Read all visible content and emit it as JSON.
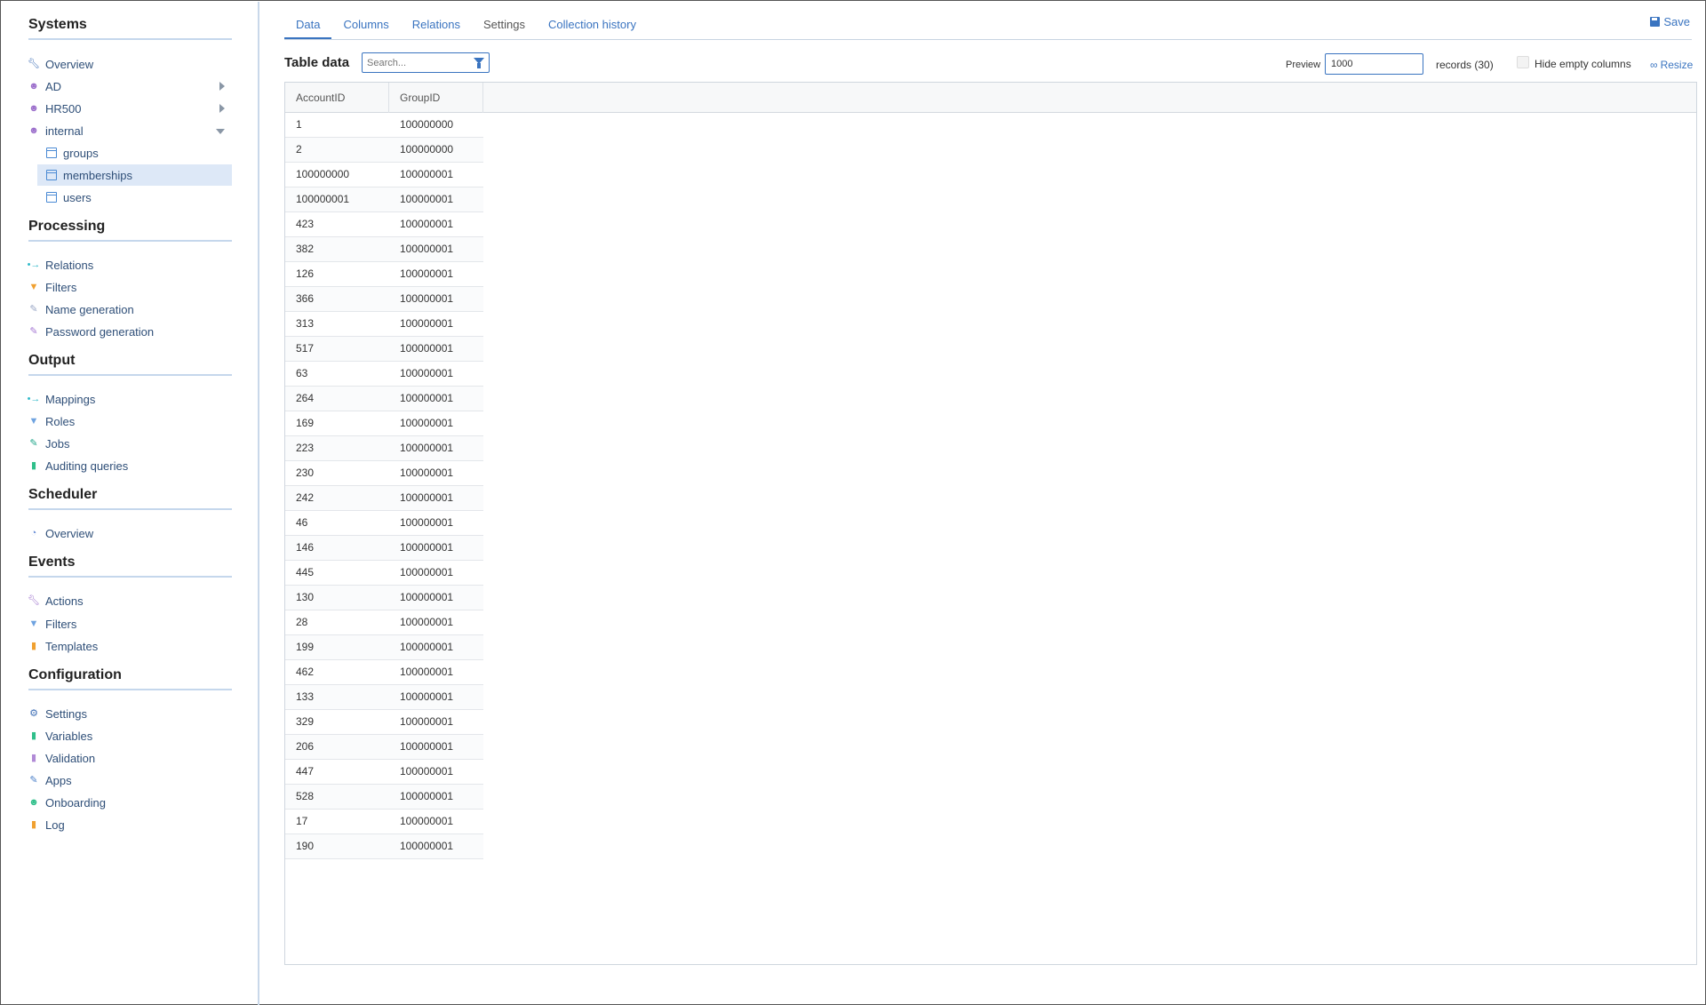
{
  "sidebar": {
    "systems": {
      "title": "Systems",
      "items": [
        {
          "label": "Overview",
          "icon": "wrench-icon"
        },
        {
          "label": "AD",
          "icon": "users-icon"
        },
        {
          "label": "HR500",
          "icon": "users-icon"
        },
        {
          "label": "internal",
          "icon": "users-icon"
        }
      ],
      "sub_items": [
        {
          "label": "groups",
          "icon": "table-icon"
        },
        {
          "label": "memberships",
          "icon": "table-icon"
        },
        {
          "label": "users",
          "icon": "table-icon"
        }
      ]
    },
    "processing": {
      "title": "Processing",
      "items": [
        {
          "label": "Relations",
          "icon": "relations-icon"
        },
        {
          "label": "Filters",
          "icon": "filter-icon"
        },
        {
          "label": "Name generation",
          "icon": "name-generation-icon"
        },
        {
          "label": "Password generation",
          "icon": "password-generation-icon"
        }
      ]
    },
    "output": {
      "title": "Output",
      "items": [
        {
          "label": "Mappings",
          "icon": "mappings-icon"
        },
        {
          "label": "Roles",
          "icon": "filter-icon"
        },
        {
          "label": "Jobs",
          "icon": "jobs-icon"
        },
        {
          "label": "Auditing queries",
          "icon": "document-icon"
        }
      ]
    },
    "scheduler": {
      "title": "Scheduler",
      "items": [
        {
          "label": "Overview",
          "icon": "clock-icon"
        }
      ]
    },
    "events": {
      "title": "Events",
      "items": [
        {
          "label": "Actions",
          "icon": "wrench-icon"
        },
        {
          "label": "Filters",
          "icon": "filter-icon"
        },
        {
          "label": "Templates",
          "icon": "document-icon"
        }
      ]
    },
    "configuration": {
      "title": "Configuration",
      "items": [
        {
          "label": "Settings",
          "icon": "gear-icon"
        },
        {
          "label": "Variables",
          "icon": "document-icon"
        },
        {
          "label": "Validation",
          "icon": "document-icon"
        },
        {
          "label": "Apps",
          "icon": "apps-icon"
        },
        {
          "label": "Onboarding",
          "icon": "users-icon"
        },
        {
          "label": "Log",
          "icon": "document-icon"
        }
      ]
    }
  },
  "tabs": [
    {
      "label": "Data"
    },
    {
      "label": "Columns"
    },
    {
      "label": "Relations"
    },
    {
      "label": "Settings"
    },
    {
      "label": "Collection history"
    }
  ],
  "toolbar": {
    "save_label": "Save",
    "table_title": "Table data",
    "search_placeholder": "Search...",
    "preview_label": "Preview",
    "preview_value": "1000",
    "records_label": "records (30)",
    "hide_empty_label": "Hide empty columns",
    "resize_label": "Resize"
  },
  "table": {
    "columns": [
      "AccountID",
      "GroupID"
    ],
    "rows": [
      [
        "1",
        "100000000"
      ],
      [
        "2",
        "100000000"
      ],
      [
        "100000000",
        "100000001"
      ],
      [
        "100000001",
        "100000001"
      ],
      [
        "423",
        "100000001"
      ],
      [
        "382",
        "100000001"
      ],
      [
        "126",
        "100000001"
      ],
      [
        "366",
        "100000001"
      ],
      [
        "313",
        "100000001"
      ],
      [
        "517",
        "100000001"
      ],
      [
        "63",
        "100000001"
      ],
      [
        "264",
        "100000001"
      ],
      [
        "169",
        "100000001"
      ],
      [
        "223",
        "100000001"
      ],
      [
        "230",
        "100000001"
      ],
      [
        "242",
        "100000001"
      ],
      [
        "46",
        "100000001"
      ],
      [
        "146",
        "100000001"
      ],
      [
        "445",
        "100000001"
      ],
      [
        "130",
        "100000001"
      ],
      [
        "28",
        "100000001"
      ],
      [
        "199",
        "100000001"
      ],
      [
        "462",
        "100000001"
      ],
      [
        "133",
        "100000001"
      ],
      [
        "329",
        "100000001"
      ],
      [
        "206",
        "100000001"
      ],
      [
        "447",
        "100000001"
      ],
      [
        "528",
        "100000001"
      ],
      [
        "17",
        "100000001"
      ],
      [
        "190",
        "100000001"
      ]
    ]
  }
}
